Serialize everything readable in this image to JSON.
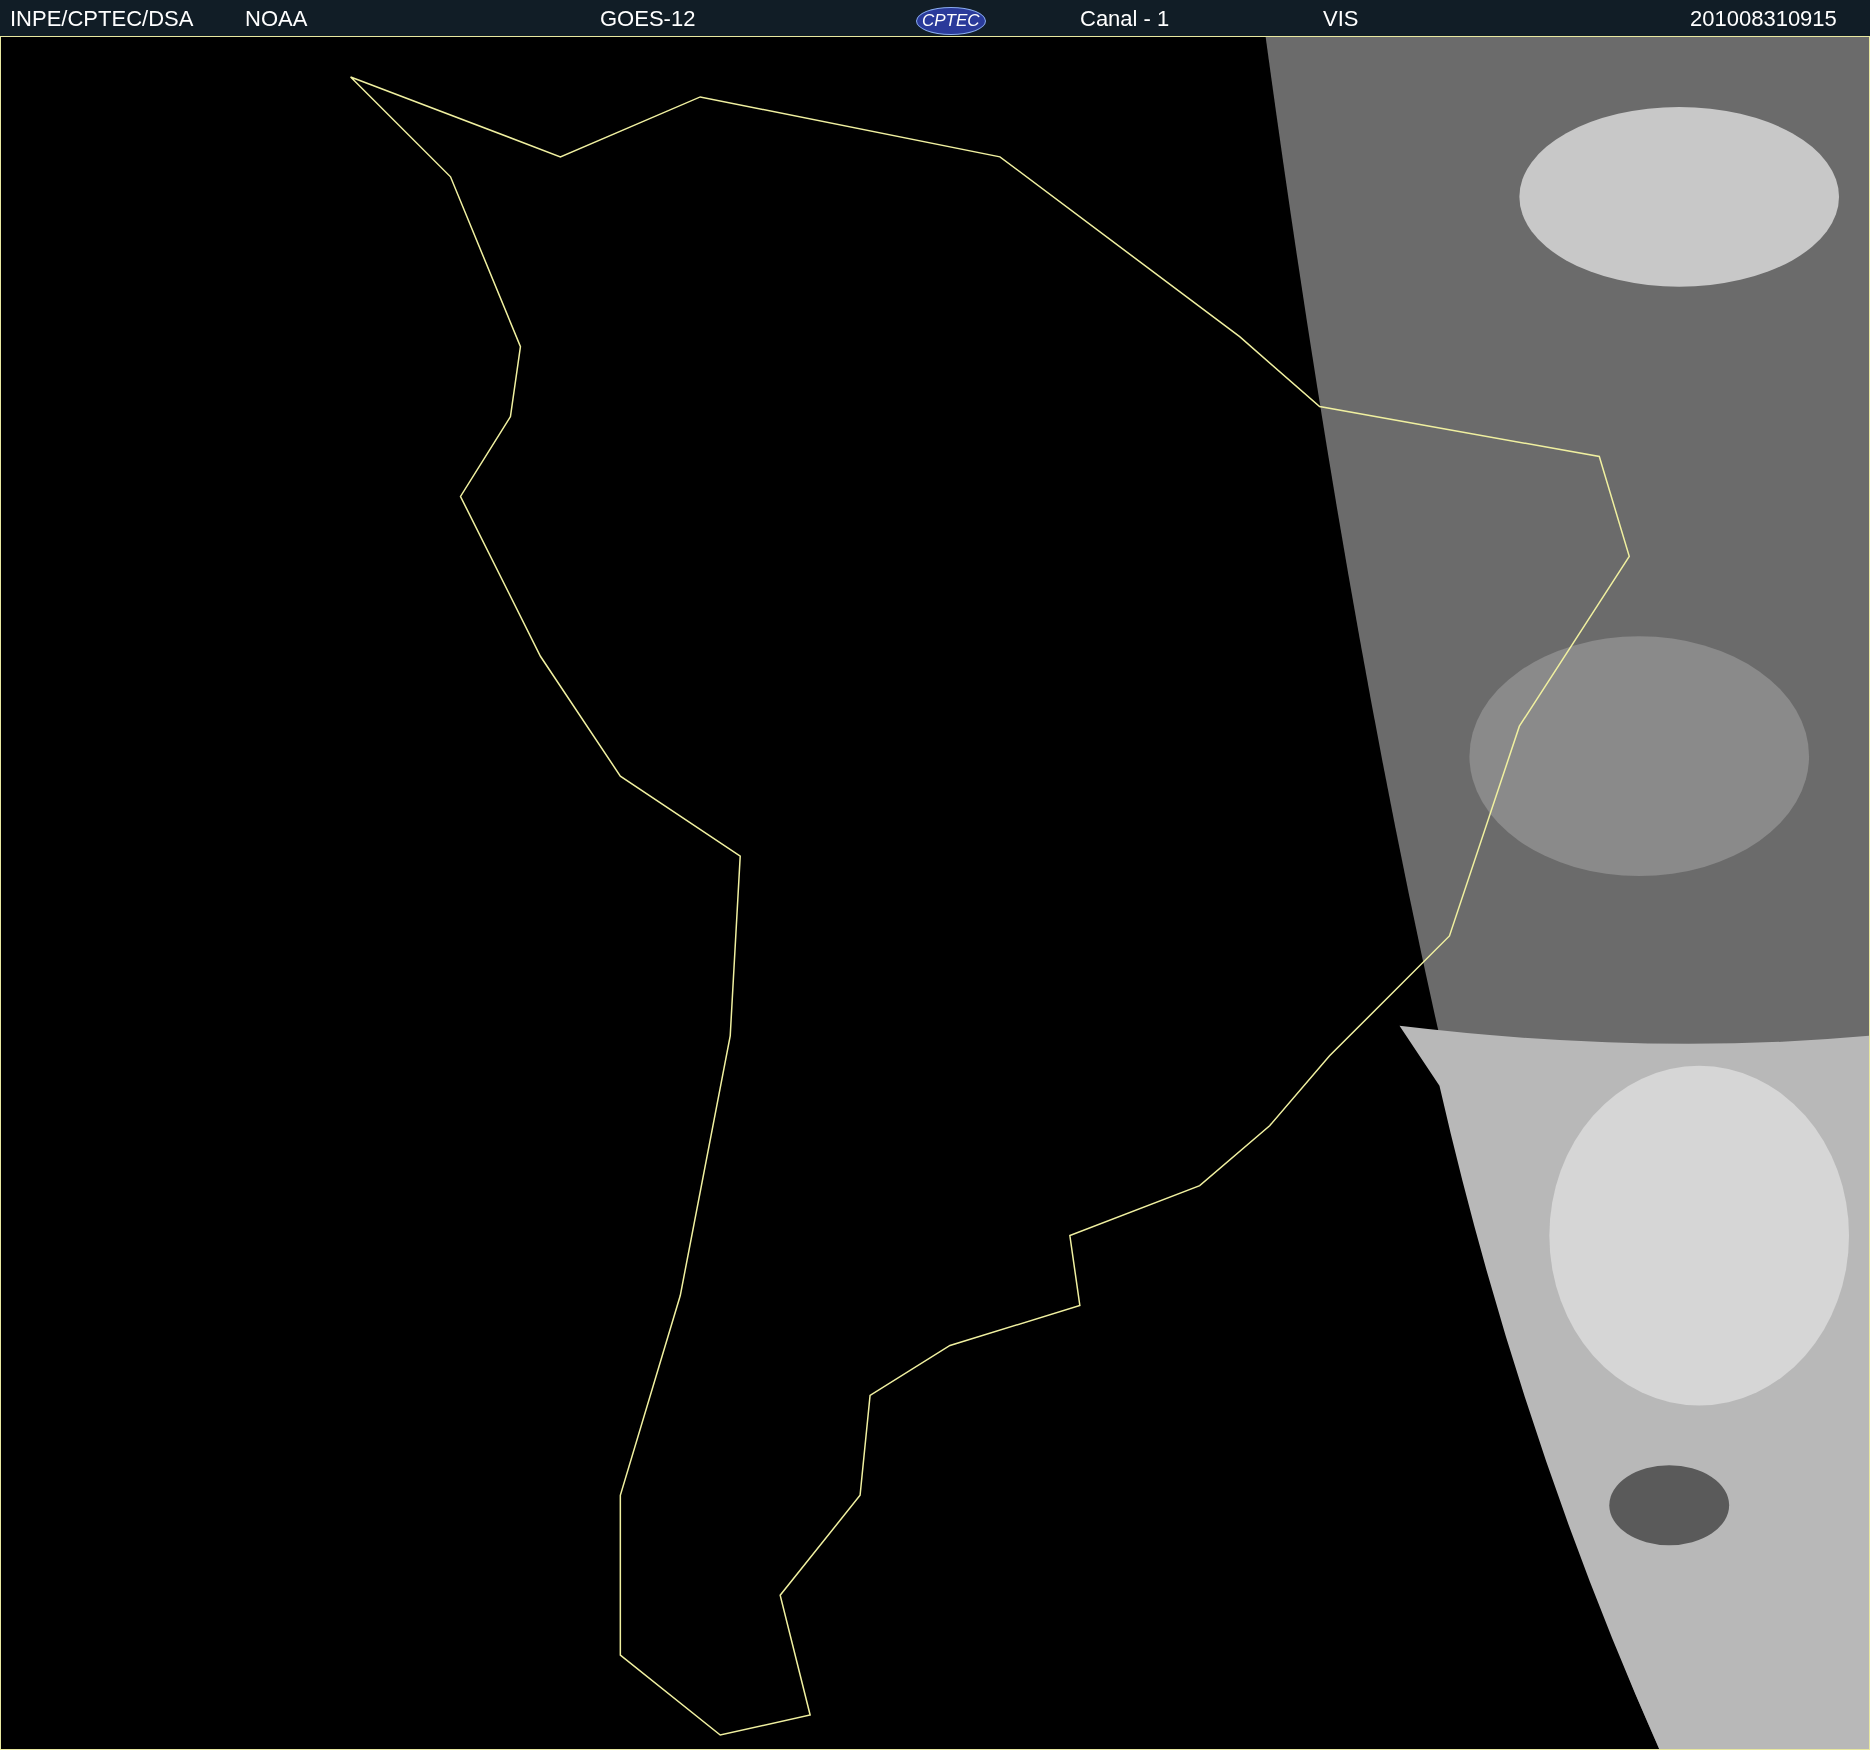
{
  "header": {
    "source": "INPE/CPTEC/DSA",
    "agency": "NOAA",
    "satellite": "GOES-12",
    "logo": "CPTEC",
    "channel": "Canal - 1",
    "band": "VIS",
    "timestamp": "201008310915"
  }
}
